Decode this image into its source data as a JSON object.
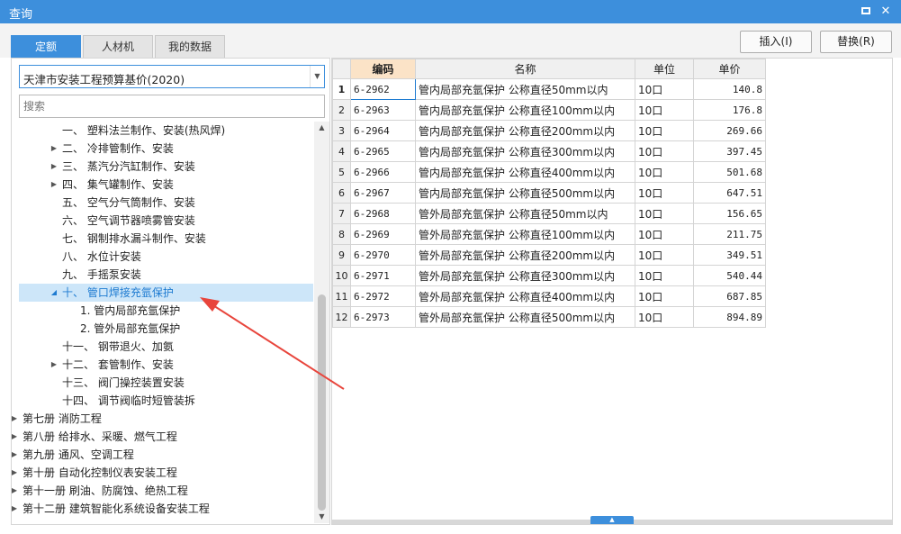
{
  "window": {
    "title": "查询",
    "max_glyph": "",
    "close_glyph": "✕"
  },
  "tabs": [
    {
      "label": "定额",
      "active": true
    },
    {
      "label": "人材机",
      "active": false
    },
    {
      "label": "我的数据",
      "active": false
    }
  ],
  "actions": {
    "insert": "插入(I)",
    "replace": "替换(R)"
  },
  "library": {
    "selected": "天津市安装工程预算基价(2020)"
  },
  "search": {
    "placeholder": "搜索"
  },
  "tree": [
    {
      "label": "一、 塑料法兰制作、安装(热风焊)",
      "arrow": "",
      "depth": 2
    },
    {
      "label": "二、 冷排管制作、安装",
      "arrow": "▶",
      "depth": 2
    },
    {
      "label": "三、 蒸汽分汽缸制作、安装",
      "arrow": "▶",
      "depth": 2
    },
    {
      "label": "四、 集气罐制作、安装",
      "arrow": "▶",
      "depth": 2
    },
    {
      "label": "五、 空气分气筒制作、安装",
      "arrow": "",
      "depth": 2
    },
    {
      "label": "六、 空气调节器喷雾管安装",
      "arrow": "",
      "depth": 2
    },
    {
      "label": "七、 钢制排水漏斗制作、安装",
      "arrow": "",
      "depth": 2
    },
    {
      "label": "八、 水位计安装",
      "arrow": "",
      "depth": 2
    },
    {
      "label": "九、 手摇泵安装",
      "arrow": "",
      "depth": 2
    },
    {
      "label": "十、 管口焊接充氩保护",
      "arrow": "◢",
      "depth": 2,
      "selected": true
    },
    {
      "label": "1. 管内局部充氩保护",
      "arrow": "",
      "depth": 3
    },
    {
      "label": "2. 管外局部充氩保护",
      "arrow": "",
      "depth": 3
    },
    {
      "label": "十一、 钢带退火、加氨",
      "arrow": "",
      "depth": 2
    },
    {
      "label": "十二、 套管制作、安装",
      "arrow": "▶",
      "depth": 2
    },
    {
      "label": "十三、 阀门操控装置安装",
      "arrow": "",
      "depth": 2
    },
    {
      "label": "十四、 调节阀临时短管装拆",
      "arrow": "",
      "depth": 2
    },
    {
      "label": "第七册 消防工程",
      "arrow": "▶",
      "depth": 0
    },
    {
      "label": "第八册 给排水、采暖、燃气工程",
      "arrow": "▶",
      "depth": 0
    },
    {
      "label": "第九册 通风、空调工程",
      "arrow": "▶",
      "depth": 0
    },
    {
      "label": "第十册 自动化控制仪表安装工程",
      "arrow": "▶",
      "depth": 0
    },
    {
      "label": "第十一册 刷油、防腐蚀、绝热工程",
      "arrow": "▶",
      "depth": 0
    },
    {
      "label": "第十二册 建筑智能化系统设备安装工程",
      "arrow": "▶",
      "depth": 0
    }
  ],
  "scroll": {
    "up": "▲",
    "down": "▼",
    "grip": "▲"
  },
  "table": {
    "headers": {
      "code": "编码",
      "name": "名称",
      "unit": "单位",
      "price": "单价"
    },
    "rows": [
      {
        "n": "1",
        "code": "6-2962",
        "name": "管内局部充氩保护 公称直径50mm以内",
        "unit": "10口",
        "price": "140.8"
      },
      {
        "n": "2",
        "code": "6-2963",
        "name": "管内局部充氩保护 公称直径100mm以内",
        "unit": "10口",
        "price": "176.8"
      },
      {
        "n": "3",
        "code": "6-2964",
        "name": "管内局部充氩保护 公称直径200mm以内",
        "unit": "10口",
        "price": "269.66"
      },
      {
        "n": "4",
        "code": "6-2965",
        "name": "管内局部充氩保护 公称直径300mm以内",
        "unit": "10口",
        "price": "397.45"
      },
      {
        "n": "5",
        "code": "6-2966",
        "name": "管内局部充氩保护 公称直径400mm以内",
        "unit": "10口",
        "price": "501.68"
      },
      {
        "n": "6",
        "code": "6-2967",
        "name": "管内局部充氩保护 公称直径500mm以内",
        "unit": "10口",
        "price": "647.51"
      },
      {
        "n": "7",
        "code": "6-2968",
        "name": "管外局部充氩保护 公称直径50mm以内",
        "unit": "10口",
        "price": "156.65"
      },
      {
        "n": "8",
        "code": "6-2969",
        "name": "管外局部充氩保护 公称直径100mm以内",
        "unit": "10口",
        "price": "211.75"
      },
      {
        "n": "9",
        "code": "6-2970",
        "name": "管外局部充氩保护 公称直径200mm以内",
        "unit": "10口",
        "price": "349.51"
      },
      {
        "n": "10",
        "code": "6-2971",
        "name": "管外局部充氩保护 公称直径300mm以内",
        "unit": "10口",
        "price": "540.44"
      },
      {
        "n": "11",
        "code": "6-2972",
        "name": "管外局部充氩保护 公称直径400mm以内",
        "unit": "10口",
        "price": "687.85"
      },
      {
        "n": "12",
        "code": "6-2973",
        "name": "管外局部充氩保护 公称直径500mm以内",
        "unit": "10口",
        "price": "894.89"
      }
    ]
  },
  "annotation": {
    "arrow_color": "#e8453c"
  }
}
